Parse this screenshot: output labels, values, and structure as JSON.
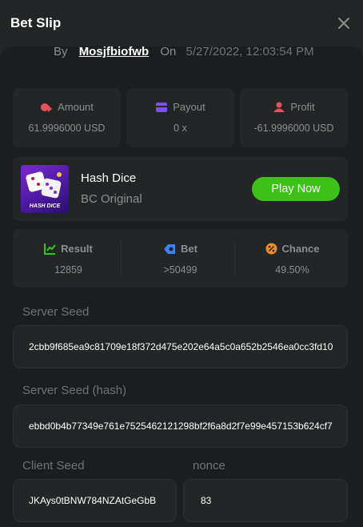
{
  "header": {
    "title": "Bet Slip",
    "close_icon": "close-icon"
  },
  "byline": {
    "by": "By",
    "username": "Mosjfbiofwb",
    "on": "On",
    "datetime": "5/27/2022, 12:03:54 PM"
  },
  "stats": {
    "amount": {
      "label": "Amount",
      "value": "61.9996000 USD",
      "icon": "coins-icon",
      "color": "#e8505b"
    },
    "payout": {
      "label": "Payout",
      "value": "0 x",
      "icon": "wallet-icon",
      "color": "#7d4dff"
    },
    "profit": {
      "label": "Profit",
      "value": "-61.9996000 USD",
      "icon": "profit-icon",
      "color": "#e8505b"
    }
  },
  "game": {
    "name": "Hash Dice",
    "subtitle": "BC Original",
    "thumb_label": "HASH DICE",
    "play_label": "Play Now"
  },
  "results": {
    "result": {
      "label": "Result",
      "value": "12859",
      "icon": "chart-icon",
      "color": "#3bc117"
    },
    "bet": {
      "label": "Bet",
      "value": ">50499",
      "icon": "target-icon",
      "color": "#3b82f6"
    },
    "chance": {
      "label": "Chance",
      "value": "49.50%",
      "icon": "percent-icon",
      "color": "#f08a24"
    }
  },
  "server_seed": {
    "label": "Server Seed",
    "value": "2cbb9f685ea9c81709e18f372d475e202e64a5c0a652b2546ea0cc3fd10"
  },
  "server_seed_hash": {
    "label": "Server Seed (hash)",
    "value": "ebbd0b4b77349e761e7525462121298bf2f6a8d2f7e99e457153b624cf7"
  },
  "client_seed": {
    "label": "Client Seed",
    "value": "JKAys0tBNW784NZAtGeGbB"
  },
  "nonce": {
    "label": "nonce",
    "value": "83"
  }
}
